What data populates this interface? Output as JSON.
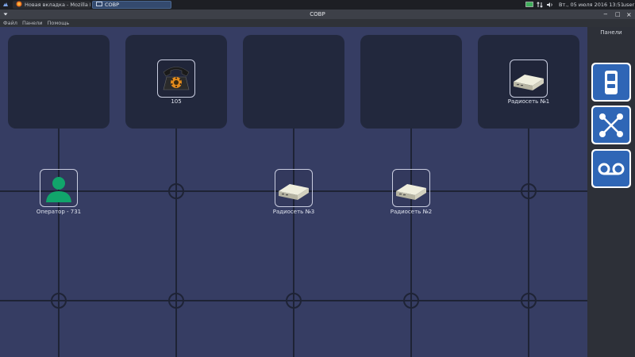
{
  "taskbar": {
    "tasks": [
      {
        "label": "Новая вкладка - Mozilla Fi..."
      },
      {
        "label": "СОВР"
      }
    ],
    "datetime": "Вт., 05 июля 2016 13:51",
    "user": "user"
  },
  "window": {
    "title": "СОВР",
    "controls": [
      "−",
      "□",
      "×"
    ]
  },
  "menu": {
    "items": [
      "Файл",
      "Панели",
      "Помощь"
    ]
  },
  "nodes": [
    {
      "label": "105",
      "icon": "phone-icon"
    },
    {
      "label": "Радиосеть №1",
      "icon": "radio-device-icon"
    },
    {
      "label": "Оператор - 731",
      "icon": "operator-icon"
    },
    {
      "label": "Радиосеть №3",
      "icon": "radio-device-icon"
    },
    {
      "label": "Радиосеть №2",
      "icon": "radio-device-icon"
    }
  ],
  "side_panel": {
    "caption": "Панели",
    "buttons": [
      "device-icon",
      "network-icon",
      "voicemail-icon"
    ]
  },
  "colors": {
    "workspace": "#363d63",
    "panel": "#22283d",
    "grid_line": "#1e2335",
    "operator_green": "#11a56b",
    "side_button": "#2f66b6"
  }
}
